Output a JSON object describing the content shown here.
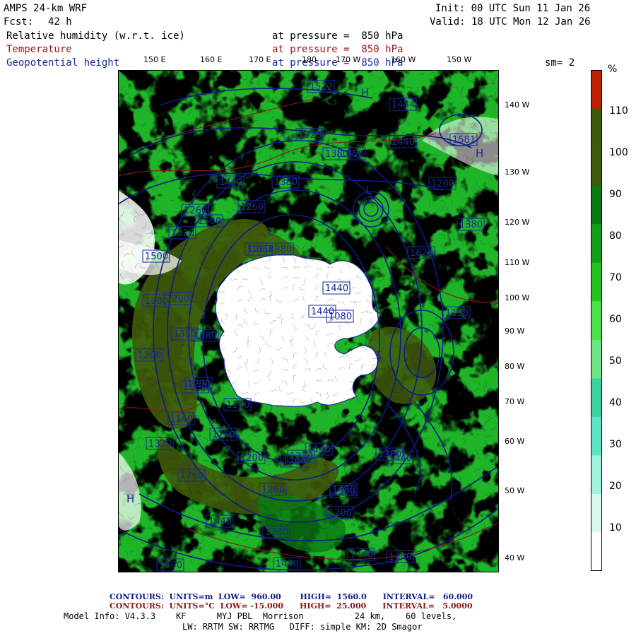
{
  "header": {
    "model": "AMPS 24-km WRF",
    "fcst_label": "Fcst:",
    "fcst_value": "42 h",
    "init": "Init: 00 UTC Sun 11 Jan 26",
    "valid": "Valid: 18 UTC Mon 12 Jan 26",
    "sm": "sm= 2",
    "fields": [
      {
        "name": "Relative humidity (w.r.t. ice)",
        "level": "at pressure =  850 hPa",
        "color": "#000000"
      },
      {
        "name": "Temperature",
        "level": "at pressure =  850 hPa",
        "color": "#a01818"
      },
      {
        "name": "Geopotential height",
        "level": "at pressure =  850 hPa",
        "color": "#1a2a9a"
      }
    ]
  },
  "map": {
    "top_longitudes": [
      "150 E",
      "160 E",
      "170 E",
      "180",
      "170 W",
      "160 W",
      "150 W"
    ],
    "right_longitudes": [
      "140 W",
      "130 W",
      "120 W",
      "110 W",
      "100 W",
      "90 W",
      "80 W",
      "70 W",
      "60 W",
      "50 W",
      "40 W"
    ],
    "height_labels": [
      "1512",
      "1484",
      "1581",
      "1320",
      "1440",
      "1380",
      "1350",
      "1380",
      "1440",
      "1260",
      "1200",
      "1500",
      "1260",
      "1380",
      "1320",
      "1500",
      "1620",
      "1260",
      "1380",
      "1440",
      "1058",
      "1440",
      "1080",
      "1200",
      "1380",
      "1198",
      "1380",
      "1080",
      "1290",
      "1140",
      "1034",
      "1200",
      "1140",
      "1260",
      "1200",
      "1140",
      "1320",
      "1500",
      "1200",
      "1260",
      "1440",
      "1260",
      "1320",
      "1440",
      "1380",
      "1200",
      "1500",
      "1440",
      "1440",
      "1440",
      "1320",
      "1380"
    ],
    "height_label_color": "#1a2a9a",
    "temperature_label_color": "#a01818",
    "low_high_markers": [
      "L",
      "L",
      "L",
      "L",
      "H",
      "H",
      "H"
    ]
  },
  "colorbar": {
    "unit": "%",
    "ticks": [
      "110",
      "100",
      "90",
      "80",
      "70",
      "60",
      "50",
      "40",
      "30",
      "20",
      "10"
    ],
    "colors": [
      "#c02000",
      "#3d5a08",
      "#3f5a0a",
      "#0a7a14",
      "#139d1c",
      "#25c222",
      "#4fe04a",
      "#6fe585",
      "#3cd39f",
      "#5ee6c4",
      "#9ff2dc",
      "#d9fbf2",
      "#ffffff"
    ]
  },
  "footer": {
    "contours_height": "CONTOURS:  UNITS=m  LOW=  960.00       HIGH=  1560.0      INTERVAL=   60.000",
    "contours_temp": "CONTOURS:  UNITS=°C  LOW= -15.000      HIGH=  25.000      INTERVAL=   5.0000",
    "model_info_1": "Model Info: V4.3.3    KF      MYJ PBL  Morrison          24 km,    60 levels,",
    "model_info_2": "LW: RRTM SW: RRTMG   DIFF: simple KM: 2D Smagor"
  }
}
